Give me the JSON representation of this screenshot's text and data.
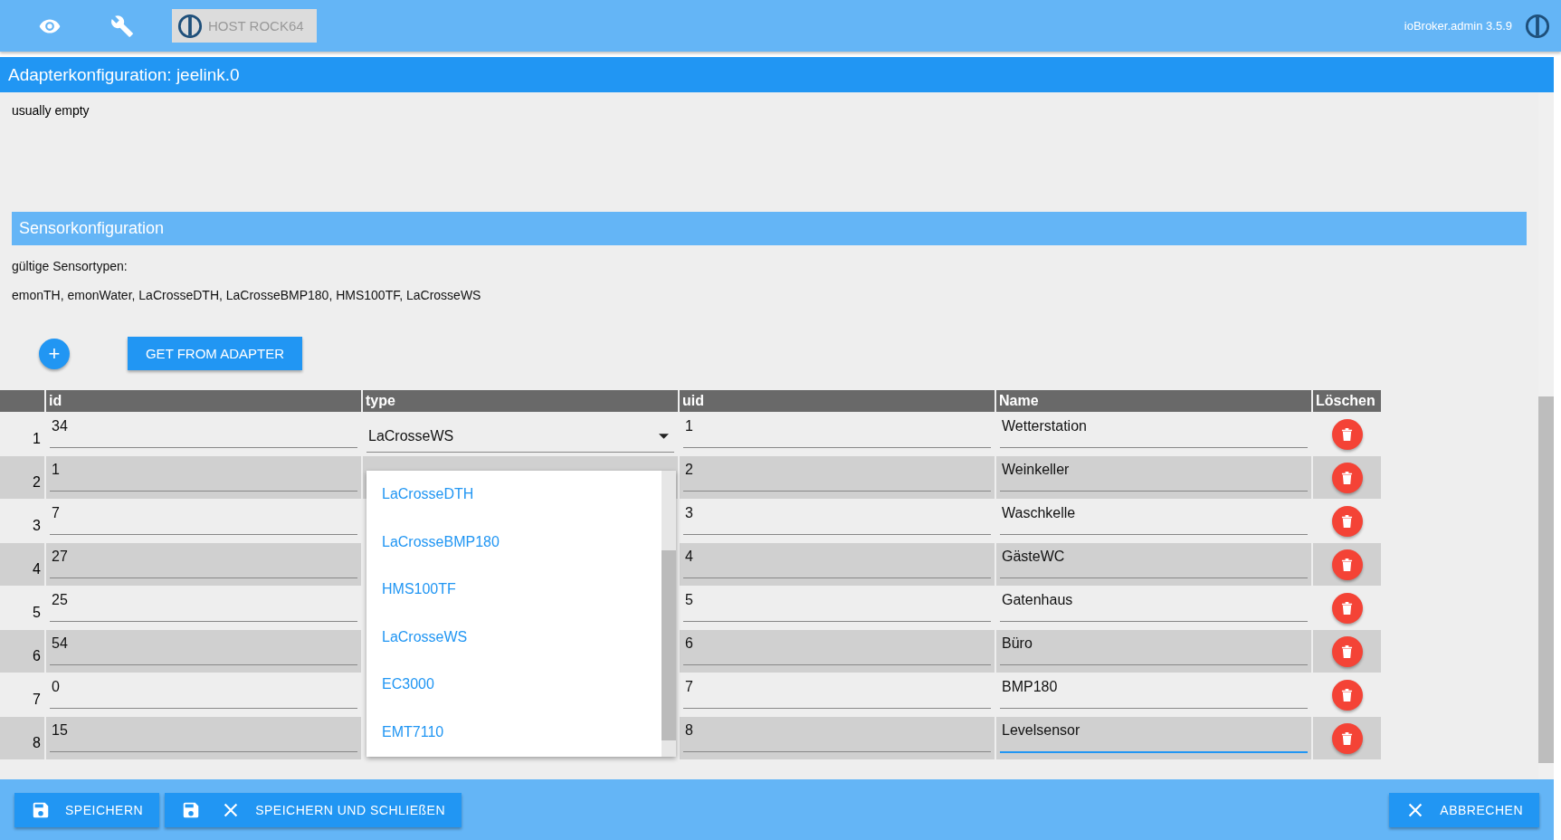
{
  "top_bar": {
    "host_button": "HOST ROCK64",
    "version": "ioBroker.admin 3.5.9"
  },
  "dialog": {
    "title": "Adapterkonfiguration: jeelink.0",
    "note": "usually empty",
    "section_title": "Sensorkonfiguration",
    "types_label": "gültige Sensortypen:",
    "types_list": "emonTH, emonWater, LaCrosseDTH, LaCrosseBMP180, HMS100TF, LaCrosseWS",
    "add_button": "+",
    "get_button": "GET FROM ADAPTER",
    "table": {
      "columns": [
        "id",
        "type",
        "uid",
        "Name",
        "Löschen"
      ],
      "rows": [
        {
          "number": "1",
          "id": "34",
          "type": "LaCrosseWS",
          "uid": "1",
          "name": "Wetterstation",
          "focused": false
        },
        {
          "number": "2",
          "id": "1",
          "uid": "2",
          "name": "Weinkeller",
          "focused": false
        },
        {
          "number": "3",
          "id": "7",
          "uid": "3",
          "name": "Waschkelle",
          "focused": false
        },
        {
          "number": "4",
          "id": "27",
          "uid": "4",
          "name": "GästeWC",
          "focused": false
        },
        {
          "number": "5",
          "id": "25",
          "uid": "5",
          "name": "Gatenhaus",
          "focused": false
        },
        {
          "number": "6",
          "id": "54",
          "uid": "6",
          "name": "Büro",
          "focused": false
        },
        {
          "number": "7",
          "id": "0",
          "uid": "7",
          "name": "BMP180",
          "focused": false
        },
        {
          "number": "8",
          "id": "15",
          "uid": "8",
          "name": "Levelsensor",
          "focused": true
        }
      ],
      "type_menu": [
        "LaCrosseDTH",
        "LaCrosseBMP180",
        "HMS100TF",
        "LaCrosseWS",
        "EC3000",
        "EMT7110"
      ]
    },
    "buttons": [
      {
        "kind": "save",
        "label": "SPEICHERN"
      },
      {
        "kind": "save_close",
        "label": "SPEICHERN UND SCHLIEßEN"
      },
      {
        "kind": "cancel",
        "label": "ABBRECHEN"
      }
    ]
  }
}
